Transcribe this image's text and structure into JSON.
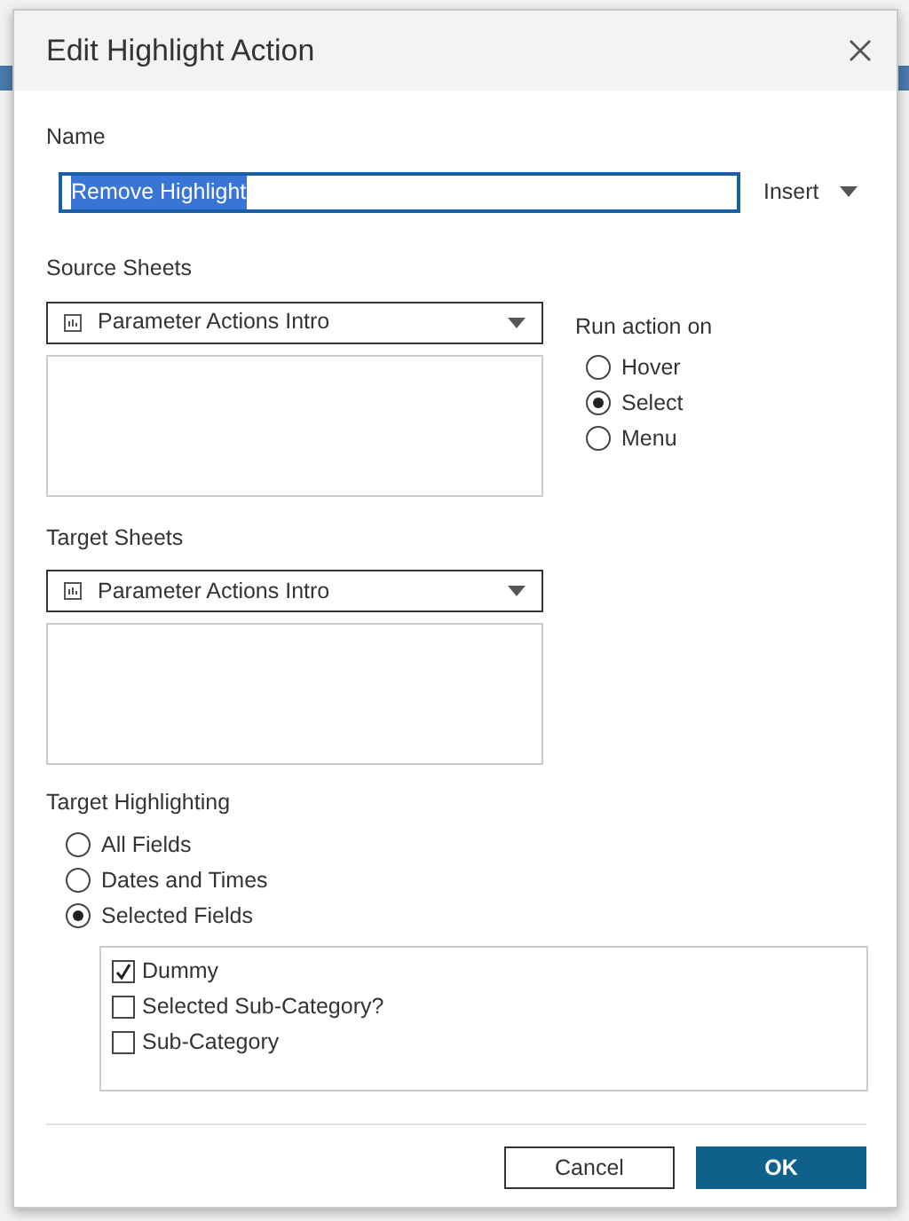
{
  "dialog": {
    "title": "Edit Highlight Action"
  },
  "name": {
    "label": "Name",
    "value": "Remove Highlight",
    "text_selected": true,
    "insert_label": "Insert"
  },
  "source_sheets": {
    "label": "Source Sheets",
    "dropdown": "Parameter Actions Intro"
  },
  "run_action_on": {
    "label": "Run action on",
    "options": [
      {
        "label": "Hover",
        "selected": false
      },
      {
        "label": "Select",
        "selected": true
      },
      {
        "label": "Menu",
        "selected": false
      }
    ]
  },
  "target_sheets": {
    "label": "Target Sheets",
    "dropdown": "Parameter Actions Intro"
  },
  "target_highlighting": {
    "label": "Target Highlighting",
    "options": [
      {
        "label": "All Fields",
        "selected": false
      },
      {
        "label": "Dates and Times",
        "selected": false
      },
      {
        "label": "Selected Fields",
        "selected": true
      }
    ],
    "fields": [
      {
        "label": "Dummy",
        "checked": true
      },
      {
        "label": "Selected Sub-Category?",
        "checked": false
      },
      {
        "label": "Sub-Category",
        "checked": false
      }
    ]
  },
  "buttons": [
    {
      "label": "Cancel",
      "kind": "secondary"
    },
    {
      "label": "OK",
      "kind": "primary"
    }
  ]
}
